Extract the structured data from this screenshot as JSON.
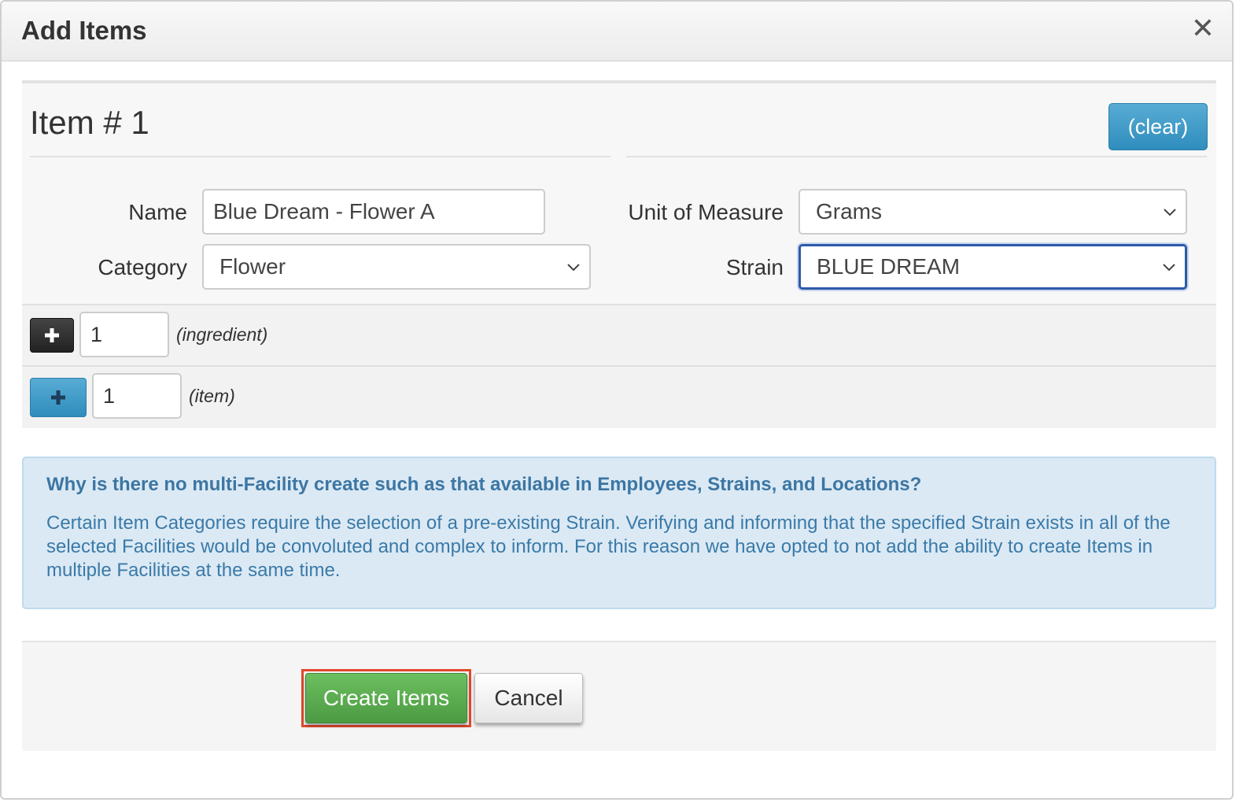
{
  "dialog": {
    "title": "Add Items",
    "close_icon": "close-icon"
  },
  "item": {
    "heading": "Item # 1",
    "clear_label": "(clear)",
    "name_label": "Name",
    "name_value": "Blue Dream - Flower A",
    "category_label": "Category",
    "category_value": "Flower",
    "uom_label": "Unit of Measure",
    "uom_value": "Grams",
    "strain_label": "Strain",
    "strain_value": "BLUE DREAM"
  },
  "ingredient_row": {
    "quantity": "1",
    "hint": "(ingredient)",
    "icon": "plus-icon"
  },
  "item_row": {
    "quantity": "1",
    "hint": "(item)",
    "icon": "plus-icon"
  },
  "info": {
    "title": "Why is there no multi-Facility create such as that available in Employees, Strains, and Locations?",
    "body": "Certain Item Categories require the selection of a pre-existing Strain. Verifying and informing that the specified Strain exists in all of the selected Facilities would be convoluted and complex to inform. For this reason we have opted to not add the ability to create Items in multiple Facilities at the same time."
  },
  "footer": {
    "create_label": "Create Items",
    "cancel_label": "Cancel"
  },
  "colors": {
    "accent_blue": "#2f8dbd",
    "create_green": "#4c9a43",
    "highlight_red": "#e0482c",
    "info_bg": "#dbe9f4"
  }
}
